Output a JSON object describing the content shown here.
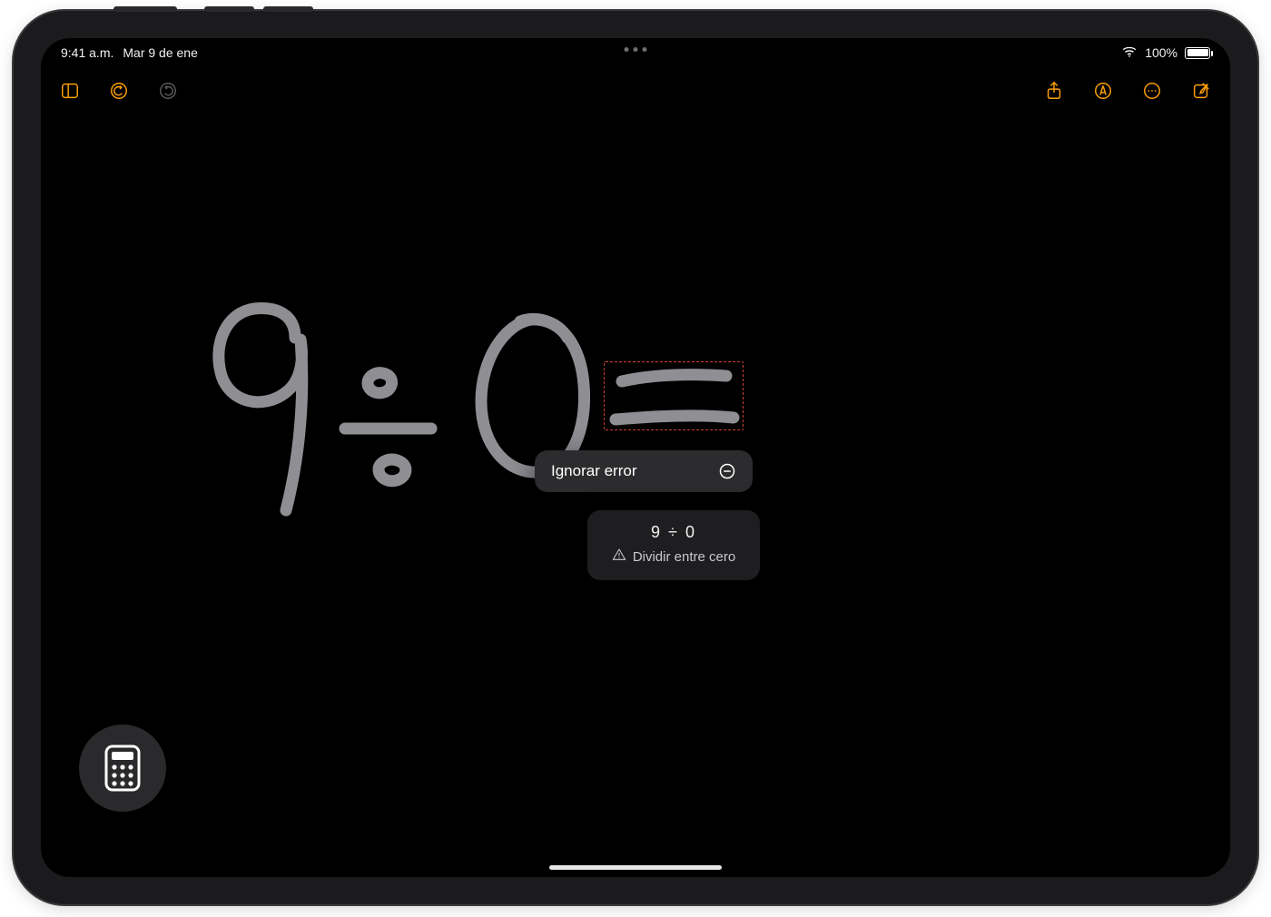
{
  "statusbar": {
    "time": "9:41 a.m.",
    "date": "Mar 9 de ene",
    "battery_pct": "100%"
  },
  "toolbar": {
    "sidebar": "sidebar",
    "undo": "undo",
    "redo": "redo",
    "share": "share",
    "markup": "markup",
    "more": "more",
    "compose": "compose"
  },
  "math": {
    "handwritten_expression": "9 ÷ 0 =",
    "recognized_expression": "9 ÷ 0"
  },
  "popover": {
    "ignore_label": "Ignorar error",
    "warning_label": "Dividir entre cero"
  },
  "fab": {
    "name": "calculator"
  }
}
